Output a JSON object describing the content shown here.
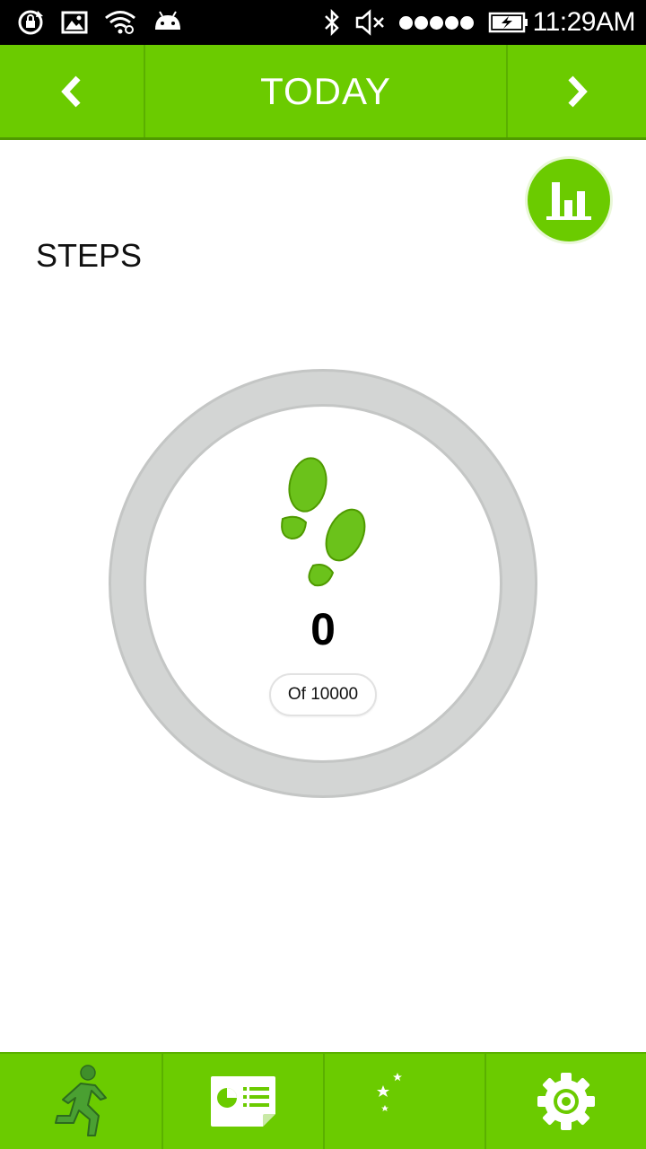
{
  "status_bar": {
    "time": "11:29AM",
    "icons": [
      "screen-rotation-lock-icon",
      "image-icon",
      "wifi-icon",
      "android-icon",
      "bluetooth-icon",
      "mute-icon",
      "signal-dots-icon",
      "battery-charging-icon"
    ]
  },
  "nav": {
    "title": "TODAY",
    "prev_icon": "chevron-left-icon",
    "next_icon": "chevron-right-icon"
  },
  "content": {
    "section_title": "STEPS",
    "steps_value": "0",
    "goal_text": "Of 10000",
    "progress": 0,
    "stats_icon": "bar-chart-icon",
    "center_icon": "footprints-icon"
  },
  "bottom_tabs": [
    {
      "icon": "running-person-icon",
      "selected": true
    },
    {
      "icon": "report-card-icon",
      "selected": false
    },
    {
      "icon": "moon-stars-icon",
      "selected": false
    },
    {
      "icon": "gear-icon",
      "selected": false
    }
  ],
  "colors": {
    "accent": "#6bcb00",
    "ring": "#d2d4d3",
    "status_bar": "#000000"
  }
}
